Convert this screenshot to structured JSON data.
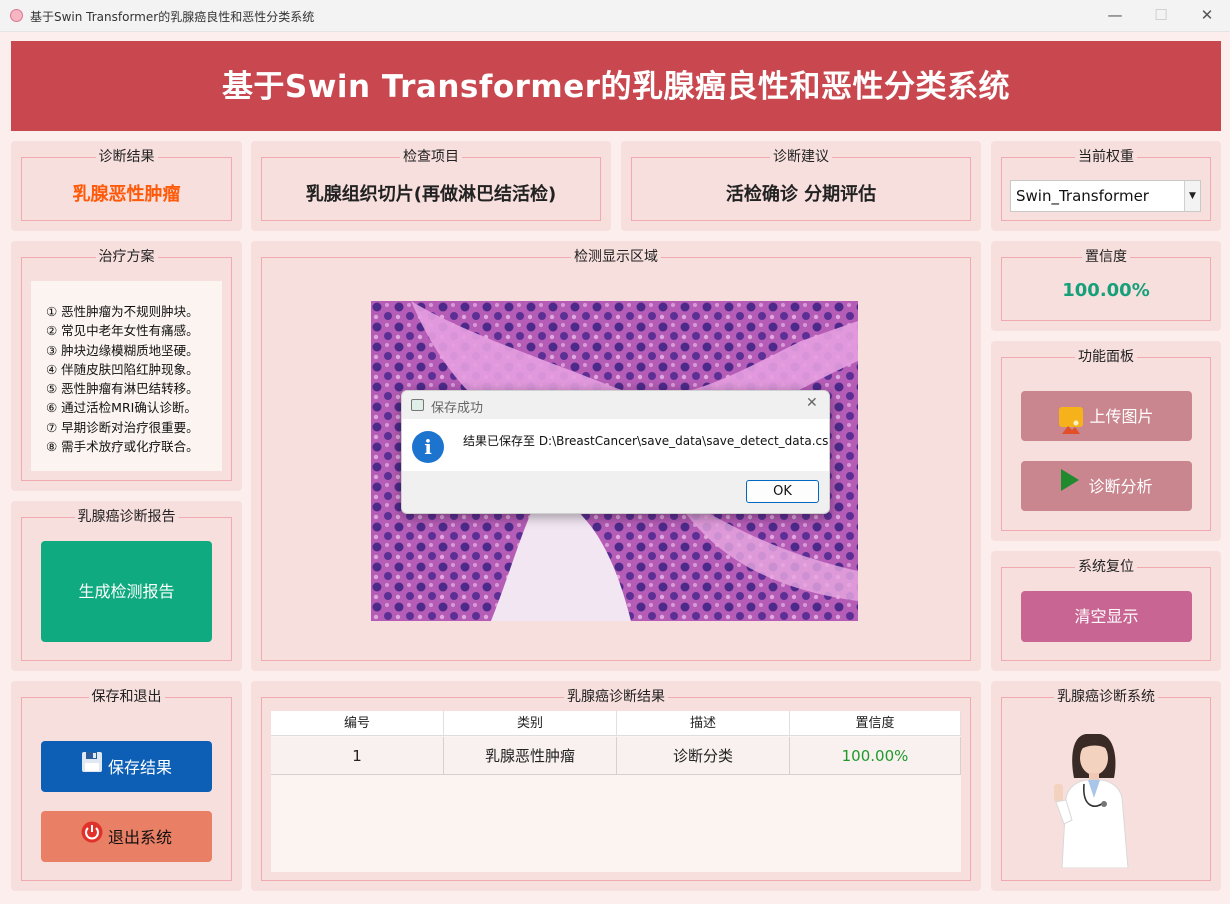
{
  "window": {
    "title": "基于Swin Transformer的乳腺癌良性和恶性分类系统",
    "minimize": "—",
    "maximize": "☐",
    "close": "✕"
  },
  "header": {
    "title": "基于Swin Transformer的乳腺癌良性和恶性分类系统"
  },
  "diagnosis_result": {
    "title": "诊断结果",
    "value": "乳腺恶性肿瘤",
    "color": "#ff5a0a"
  },
  "exam_item": {
    "title": "检查项目",
    "value": "乳腺组织切片(再做淋巴结活检)"
  },
  "advice": {
    "title": "诊断建议",
    "value": "活检确诊 分期评估"
  },
  "weights": {
    "title": "当前权重",
    "selected": "Swin_Transformer"
  },
  "treatment": {
    "title": "治疗方案",
    "items": [
      "① 恶性肿瘤为不规则肿块。",
      "② 常见中老年女性有痛感。",
      "③ 肿块边缘模糊质地坚硬。",
      "④ 伴随皮肤凹陷红肿现象。",
      "⑤ 恶性肿瘤有淋巴结转移。",
      "⑥ 通过活检MRI确认诊断。",
      "⑦ 早期诊断对治疗很重要。",
      "⑧ 需手术放疗或化疗联合。"
    ]
  },
  "detection": {
    "title": "检测显示区域"
  },
  "confidence": {
    "title": "置信度",
    "value": "100.00%",
    "color": "#16a07a"
  },
  "functions": {
    "title": "功能面板",
    "upload_label": "上传图片",
    "analyze_label": "诊断分析"
  },
  "report": {
    "title": "乳腺癌诊断报告",
    "button_label": "生成检测报告"
  },
  "reset": {
    "title": "系统复位",
    "button_label": "清空显示"
  },
  "save_exit": {
    "title": "保存和退出",
    "save_label": "保存结果",
    "exit_label": "退出系统"
  },
  "results_table": {
    "title": "乳腺癌诊断结果",
    "columns": [
      "编号",
      "类别",
      "描述",
      "置信度"
    ],
    "rows": [
      {
        "id": "1",
        "category": "乳腺恶性肿瘤",
        "description": "诊断分类",
        "confidence": "100.00%"
      }
    ]
  },
  "system_panel": {
    "title": "乳腺癌诊断系统"
  },
  "dialog": {
    "title": "保存成功",
    "message": "结果已保存至 D:\\BreastCancer\\save_data\\save_detect_data.csv",
    "ok_label": "OK"
  },
  "colors": {
    "banner": "#c9474f",
    "panel": "#f7dfdd",
    "report_button": "#0faa7f",
    "save_button": "#0c5fb5",
    "exit_button": "#e97f64",
    "function_button": "#c9868f",
    "reset_button": "#c96592",
    "table_confidence": "#1f9a2a"
  }
}
